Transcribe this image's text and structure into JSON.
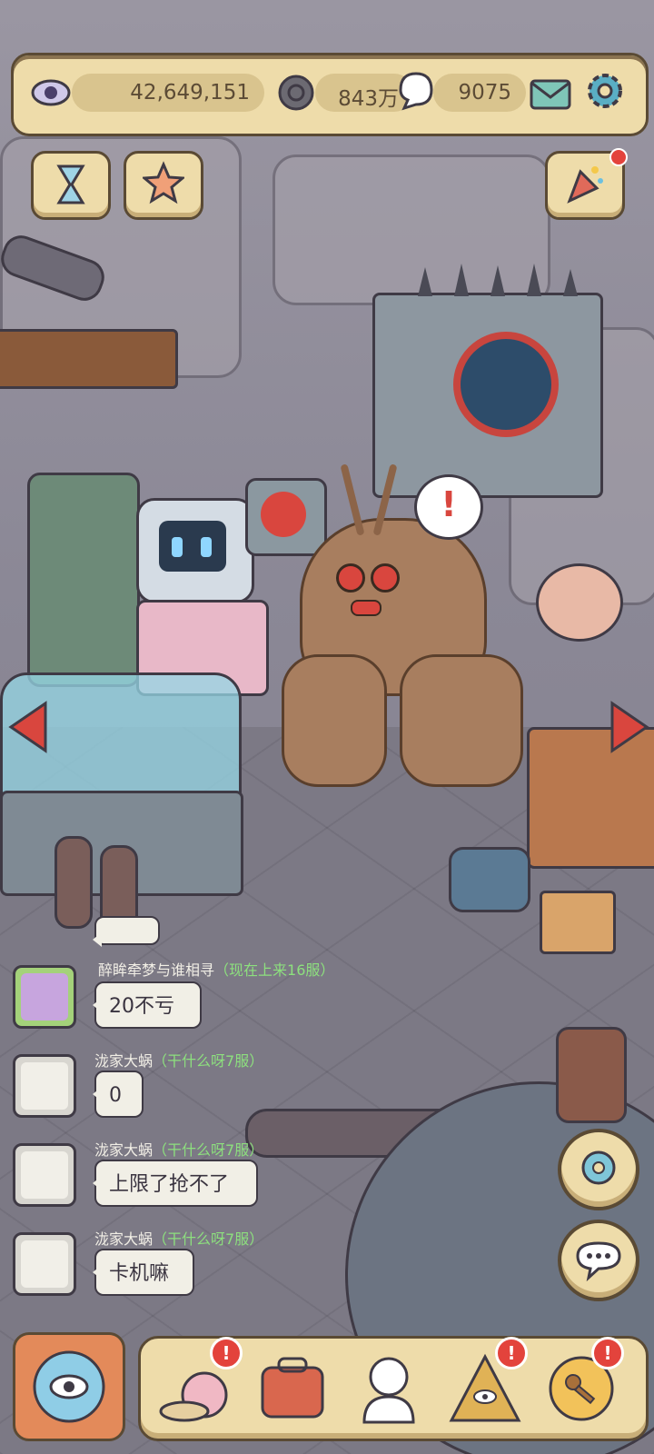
{
  "resources": {
    "eye_count": "42,649,151",
    "snail_currency": "843万",
    "soul_currency": "9075"
  },
  "icons": {
    "eye": "eye-icon",
    "mail": "mail-icon",
    "settings": "gear-icon",
    "hourglass": "hourglass-icon",
    "star": "star-icon",
    "party": "party-popper-icon",
    "arrow_left": "arrow-left-icon",
    "arrow_right": "arrow-right-icon",
    "alert": "exclamation-icon",
    "chat_bubble": "chat-bubble-icon",
    "swap": "swap-icon"
  },
  "chat": {
    "messages": [
      {
        "name": "醉眸牵梦与谁相寻",
        "server": "（现在上来16服）",
        "text": "20不亏"
      },
      {
        "name": "泷家大蜗",
        "server": "（干什么呀7服）",
        "text": "0"
      },
      {
        "name": "泷家大蜗",
        "server": "（干什么呀7服）",
        "text": "上限了抢不了"
      },
      {
        "name": "泷家大蜗",
        "server": "（干什么呀7服）",
        "text": "卡机嘛"
      }
    ]
  },
  "bottom_nav": {
    "badge": "!",
    "items": [
      "snail-nav",
      "backpack-nav",
      "bust-statue-nav",
      "pyramid-eye-nav",
      "key-badge-nav"
    ]
  },
  "colors": {
    "panel": "#eedcaa",
    "panel_border": "#5a4a34",
    "server_tag": "#8de07e",
    "badge": "#e3433c"
  }
}
